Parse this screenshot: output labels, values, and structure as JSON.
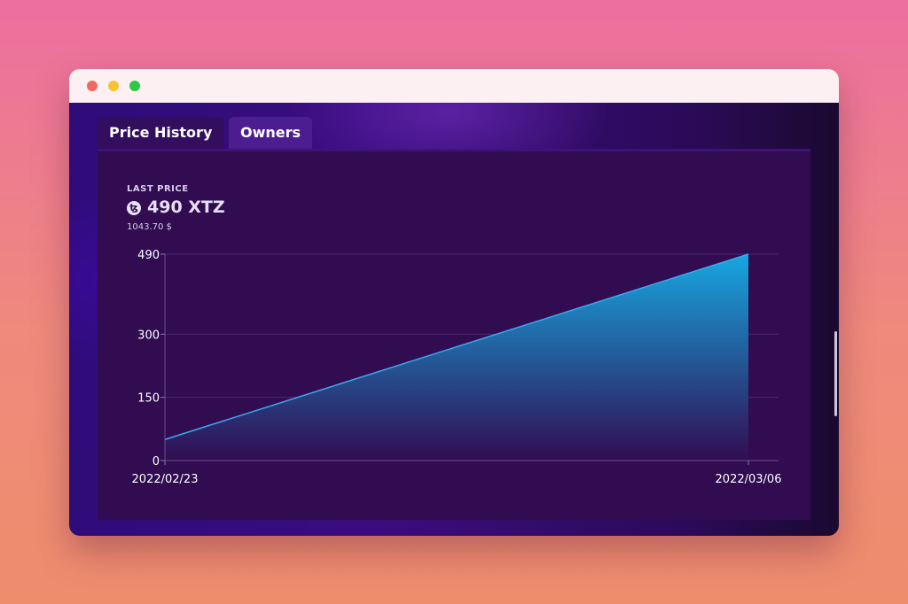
{
  "tabs": [
    {
      "label": "Price History"
    },
    {
      "label": "Owners"
    }
  ],
  "last_price": {
    "label": "LAST PRICE",
    "icon": "tezos-icon",
    "icon_glyph": "ꜩ",
    "value": "490 XTZ",
    "usd": "1043.70 $"
  },
  "chart_data": {
    "type": "area",
    "x": [
      "2022/02/23",
      "2022/03/06"
    ],
    "values": [
      50,
      490
    ],
    "yticks": [
      0,
      150,
      300,
      490
    ],
    "xticks": [
      "2022/02/23",
      "2022/03/06"
    ],
    "ylim": [
      0,
      490
    ],
    "title": "",
    "xlabel": "",
    "ylabel": "",
    "grid": true,
    "colors": {
      "line": "#3aa9ee",
      "fill_top": "#17a7e0",
      "fill_bottom": "#310c51"
    }
  }
}
